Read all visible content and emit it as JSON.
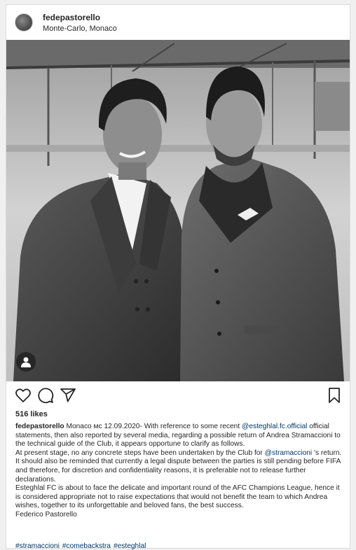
{
  "post": {
    "username": "fedepastorello",
    "location": "Monte-Carlo, Monaco",
    "likes": "516 likes"
  },
  "caption": {
    "username": "fedepastorello",
    "seg1": "Monaco мс 12.09.2020- With reference to some recent",
    "mention1": "@esteghlal.fc.official",
    "seg2": "official statements, then also reported by several media, regarding a possible return of Andrea Stramaccioni to the technical guide of the Club, it appears opportune to clarify as follows.",
    "seg3": "At present stage, no any concrete steps have been undertaken by the Club for",
    "mention2": "@stramaccioni",
    "seg4": "'s return. It should also be reminded that currently a legal dispute between the parties is still pending before FIFA and therefore, for discretion and confidentiality reasons, it is preferable not to release further declarations.",
    "seg5": "Esteghlal FC is about to face the delicate and important round of the AFC Champions League, hence it is considered appropriate not to raise expectations that would not benefit the team to which Andrea wishes, together to its unforgettable and beloved fans, the best success.",
    "seg6": "Federico Pastorello"
  },
  "hashtags": [
    "#stramaccioni",
    "#comebackstra",
    "#esteghlal"
  ],
  "icons": {
    "like": "heart-icon",
    "comment": "comment-icon",
    "share": "share-icon",
    "save": "bookmark-icon",
    "tagged": "user-tag-icon"
  }
}
